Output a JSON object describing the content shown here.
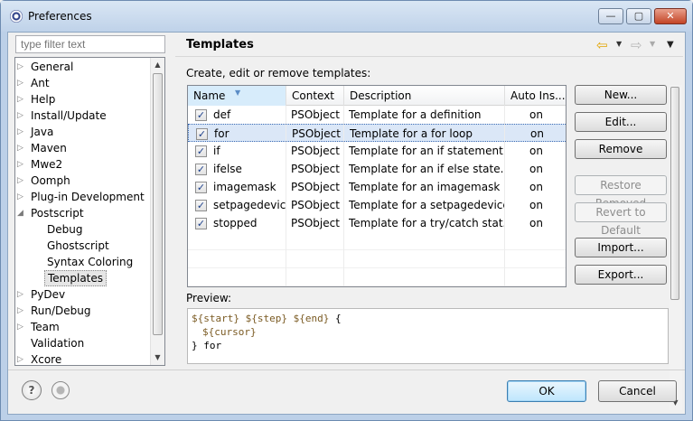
{
  "window": {
    "title": "Preferences",
    "minimize_glyph": "—",
    "maximize_glyph": "▢",
    "close_glyph": "✕"
  },
  "filter": {
    "placeholder": "type filter text"
  },
  "tree": {
    "items": [
      {
        "label": "General",
        "expanded": false,
        "level": 0
      },
      {
        "label": "Ant",
        "expanded": false,
        "level": 0
      },
      {
        "label": "Help",
        "expanded": false,
        "level": 0
      },
      {
        "label": "Install/Update",
        "expanded": false,
        "level": 0
      },
      {
        "label": "Java",
        "expanded": false,
        "level": 0
      },
      {
        "label": "Maven",
        "expanded": false,
        "level": 0
      },
      {
        "label": "Mwe2",
        "expanded": false,
        "level": 0
      },
      {
        "label": "Oomph",
        "expanded": false,
        "level": 0
      },
      {
        "label": "Plug-in Development",
        "expanded": false,
        "level": 0
      },
      {
        "label": "Postscript",
        "expanded": true,
        "level": 0
      },
      {
        "label": "Debug",
        "level": 1
      },
      {
        "label": "Ghostscript",
        "level": 1
      },
      {
        "label": "Syntax Coloring",
        "level": 1
      },
      {
        "label": "Templates",
        "level": 1,
        "selected": true
      },
      {
        "label": "PyDev",
        "expanded": false,
        "level": 0
      },
      {
        "label": "Run/Debug",
        "expanded": false,
        "level": 0
      },
      {
        "label": "Team",
        "expanded": false,
        "level": 0
      },
      {
        "label": "Validation",
        "level": 0,
        "leaf": true
      },
      {
        "label": "Xcore",
        "expanded": false,
        "level": 0
      }
    ]
  },
  "page": {
    "title": "Templates",
    "hint": "Create, edit or remove templates:"
  },
  "table": {
    "columns": [
      "Name",
      "Context",
      "Description",
      "Auto Ins..."
    ],
    "rows": [
      {
        "checked": true,
        "name": "def",
        "context": "PSObject",
        "description": "Template for a definition",
        "auto": "on"
      },
      {
        "checked": true,
        "name": "for",
        "context": "PSObject",
        "description": "Template for a for loop",
        "auto": "on",
        "selected": true
      },
      {
        "checked": true,
        "name": "if",
        "context": "PSObject",
        "description": "Template for an if statement",
        "auto": "on"
      },
      {
        "checked": true,
        "name": "ifelse",
        "context": "PSObject",
        "description": "Template for an if else state...",
        "auto": "on"
      },
      {
        "checked": true,
        "name": "imagemask",
        "context": "PSObject",
        "description": "Template for an imagemask ...",
        "auto": "on"
      },
      {
        "checked": true,
        "name": "setpagedevice",
        "context": "PSObject",
        "description": "Template for a setpagedevice...",
        "auto": "on"
      },
      {
        "checked": true,
        "name": "stopped",
        "context": "PSObject",
        "description": "Template for a try/catch stat...",
        "auto": "on"
      }
    ]
  },
  "buttons": {
    "new": "New...",
    "edit": "Edit...",
    "remove": "Remove",
    "restore_removed": "Restore Removed",
    "revert_default": "Revert to Default",
    "import": "Import...",
    "export": "Export...",
    "ok": "OK",
    "cancel": "Cancel"
  },
  "preview": {
    "label": "Preview:",
    "v_start": "${start}",
    "v_step": "${step}",
    "v_end": "${end}",
    "open": "{",
    "v_cursor": "${cursor}",
    "close": "} for"
  },
  "icons": {
    "help": "?",
    "checkmark": "✓"
  },
  "colors": {
    "selection_bg": "#dbe7f7",
    "ok_border": "#3c7fb1",
    "preview_var": "#7a5a22"
  }
}
